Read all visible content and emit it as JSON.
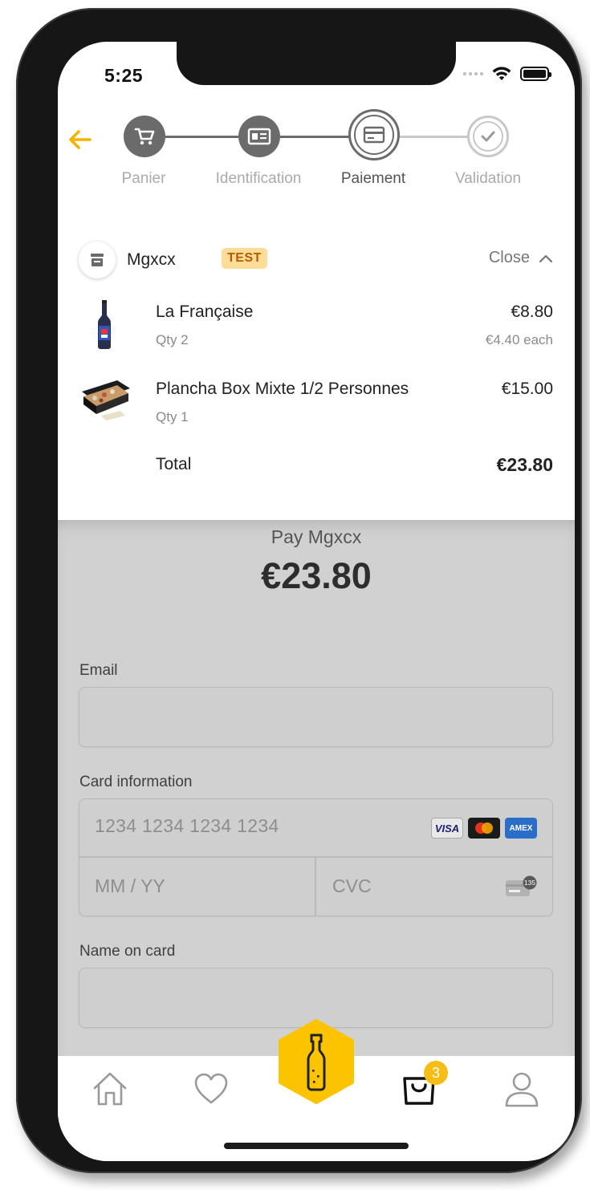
{
  "status_bar": {
    "time": "5:25"
  },
  "stepper": {
    "steps": [
      {
        "label": "Panier",
        "icon": "cart-icon",
        "state": "done"
      },
      {
        "label": "Identification",
        "icon": "id-card-icon",
        "state": "done"
      },
      {
        "label": "Paiement",
        "icon": "credit-card-icon",
        "state": "active"
      },
      {
        "label": "Validation",
        "icon": "check-circle-icon",
        "state": "pending"
      }
    ],
    "colors": {
      "done": "#6b6b6b",
      "active": "#6b6b6b",
      "pending": "#c8c8c8",
      "back_arrow": "#f5b400"
    }
  },
  "order_summary": {
    "merchant": "Mgxcx",
    "badge": "TEST",
    "toggle_label": "Close",
    "items": [
      {
        "name": "La Française",
        "qty": "Qty 2",
        "price": "€8.80",
        "each": "€4.40 each"
      },
      {
        "name": "Plancha Box Mixte 1/2 Personnes",
        "qty": "Qty 1",
        "price": "€15.00",
        "each": ""
      }
    ],
    "total_label": "Total",
    "total_value": "€23.80"
  },
  "payment": {
    "pay_label": "Pay Mgxcx",
    "amount": "€23.80",
    "email_label": "Email",
    "email_value": "",
    "card_label": "Card information",
    "card_number_placeholder": "1234 1234 1234 1234",
    "expiry_placeholder": "MM / YY",
    "cvc_placeholder": "CVC",
    "cvc_hint": "135",
    "name_label": "Name on card",
    "name_value": "",
    "card_brands": [
      "VISA",
      "mastercard",
      "AMEX"
    ]
  },
  "tab_bar": {
    "items": [
      "home-icon",
      "heart-icon",
      "bottle-icon",
      "bag-icon",
      "user-icon"
    ],
    "cart_count": "3",
    "accent": "#fcc400"
  }
}
